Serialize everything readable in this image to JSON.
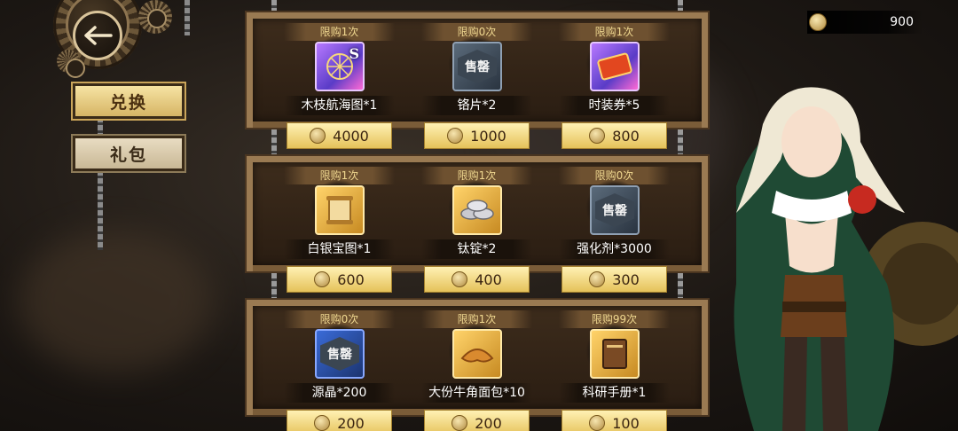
{
  "nav": {
    "back_label": "back"
  },
  "tabs": [
    {
      "label": "兑换",
      "active": true
    },
    {
      "label": "礼包",
      "active": false
    }
  ],
  "currency": {
    "icon": "medal-coin-icon",
    "amount": "900"
  },
  "shop_rows": [
    [
      {
        "limit": "限购1次",
        "name": "木枝航海图*1",
        "price": "4000",
        "rarity": "purple",
        "icon": "map-s-icon",
        "icon_text": "S"
      },
      {
        "limit": "限购0次",
        "name": "铬片*2",
        "price": "1000",
        "rarity": "dark",
        "icon": "sold-out-badge",
        "icon_text": "售罄"
      },
      {
        "limit": "限购1次",
        "name": "时装券*5",
        "price": "800",
        "rarity": "purple",
        "icon": "ticket-icon",
        "icon_text": ""
      }
    ],
    [
      {
        "limit": "限购1次",
        "name": "白银宝图*1",
        "price": "600",
        "rarity": "gold",
        "icon": "scroll-icon",
        "icon_text": ""
      },
      {
        "limit": "限购1次",
        "name": "钛锭*2",
        "price": "400",
        "rarity": "gold",
        "icon": "ingot-icon",
        "icon_text": ""
      },
      {
        "limit": "限购0次",
        "name": "强化剂*3000",
        "price": "300",
        "rarity": "dark",
        "icon": "sold-out-badge",
        "icon_text": "售罄"
      }
    ],
    [
      {
        "limit": "限购0次",
        "name": "源晶*200",
        "price": "200",
        "rarity": "blue",
        "icon": "sold-out-badge",
        "icon_text": "售罄"
      },
      {
        "limit": "限购1次",
        "name": "大份牛角面包*10",
        "price": "200",
        "rarity": "gold",
        "icon": "croissant-icon",
        "icon_text": ""
      },
      {
        "limit": "限购99次",
        "name": "科研手册*1",
        "price": "100",
        "rarity": "gold",
        "icon": "book-icon",
        "icon_text": ""
      }
    ]
  ],
  "colors": {
    "accent_gold": "#e5c25a",
    "frame": "#9a7a52",
    "limit_text": "#f0d890"
  }
}
